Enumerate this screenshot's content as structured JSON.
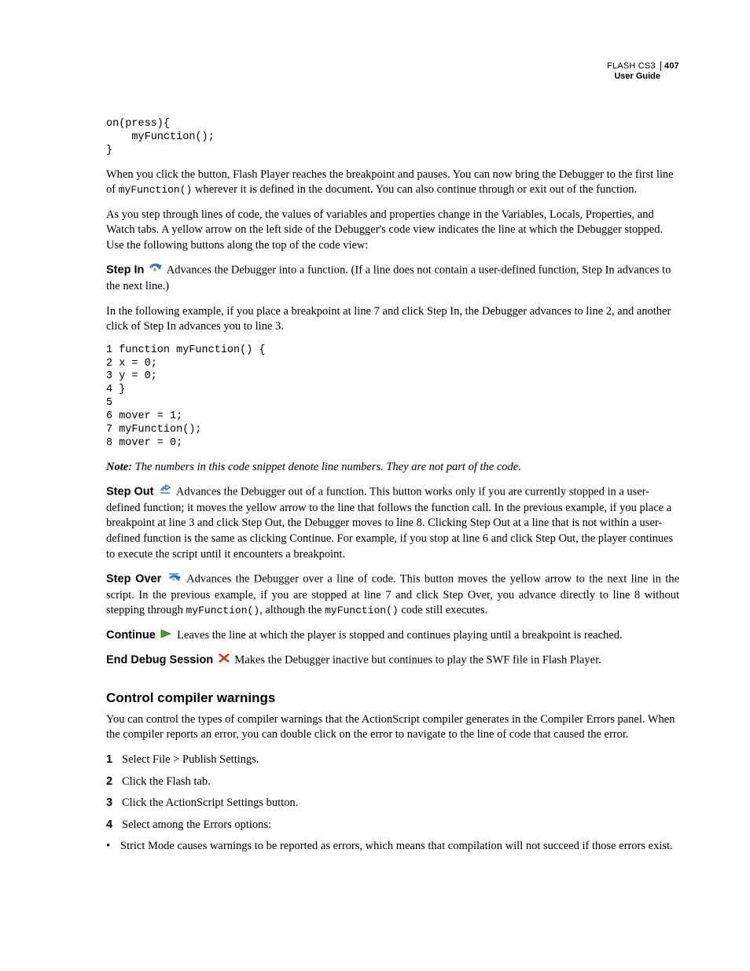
{
  "header": {
    "product": "FLASH CS3",
    "page_number": "407",
    "guide": "User Guide"
  },
  "code1": "on(press){\n    myFunction();\n}",
  "para1_a": "When you click the button, Flash Player reaches the breakpoint and pauses. You can now bring the Debugger to the first line of ",
  "para1_code": "myFunction()",
  "para1_b": " wherever it is defined in the document. You can also continue through or exit out of the function.",
  "para2": "As you step through lines of code, the values of variables and properties change in the Variables, Locals, Properties, and Watch tabs. A yellow arrow on the left side of the Debugger's code view indicates the line at which the Debugger stopped. Use the following buttons along the top of the code view:",
  "stepin_label": "Step In",
  "stepin_text": "  Advances the Debugger into a function. (If a line does not contain a user-defined function, Step In advances to the next line.)",
  "para3": "In the following example, if you place a breakpoint at line 7 and click Step In, the Debugger advances to line 2, and another click of Step In advances you to line 3.",
  "code2": "1 function myFunction() {\n2 x = 0;\n3 y = 0;\n4 }\n5\n6 mover = 1;\n7 myFunction();\n8 mover = 0;",
  "note_label": "Note:",
  "note_text": " The numbers in this code snippet denote line numbers. They are not part of the code.",
  "stepout_label": "Step Out",
  "stepout_text": "  Advances the Debugger out of a function. This button works only if you are currently stopped in a user-defined function; it moves the yellow arrow to the line that follows the function call. In the previous example, if you place a breakpoint at line 3 and click Step Out, the Debugger moves to line 8. Clicking Step Out at a line that is not within a user-defined function is the same as clicking Continue. For example, if you stop at line 6 and click Step Out, the player continues to execute the script until it encounters a breakpoint.",
  "stepover_label": "Step Over",
  "stepover_a": "  Advances the Debugger over a line of code. This button moves the yellow arrow to the next line in the script. In the previous example, if you are stopped at line 7 and click Step Over, you advance directly to line 8 without stepping through ",
  "stepover_code1": "myFunction()",
  "stepover_b": ", although the ",
  "stepover_code2": "myFunction()",
  "stepover_c": " code still executes.",
  "continue_label": "Continue",
  "continue_text": "  Leaves the line at which the player is stopped and continues playing until a breakpoint is reached.",
  "enddebug_label": "End Debug Session",
  "enddebug_text": "  Makes the Debugger inactive but continues to play the SWF file in Flash Player.",
  "section_title": "Control compiler warnings",
  "section_intro": "You can control the types of compiler warnings that the ActionScript compiler generates in the Compiler Errors panel. When the compiler reports an error, you can double click on the error to navigate to the line of code that caused the error.",
  "steps": [
    {
      "n": "1",
      "t": "Select File > Publish Settings."
    },
    {
      "n": "2",
      "t": "Click the Flash tab."
    },
    {
      "n": "3",
      "t": "Click the ActionScript Settings button."
    },
    {
      "n": "4",
      "t": "Select among the Errors options:"
    }
  ],
  "bullet1": "Strict Mode causes warnings to be reported as errors, which means that compilation will not succeed if those errors exist."
}
